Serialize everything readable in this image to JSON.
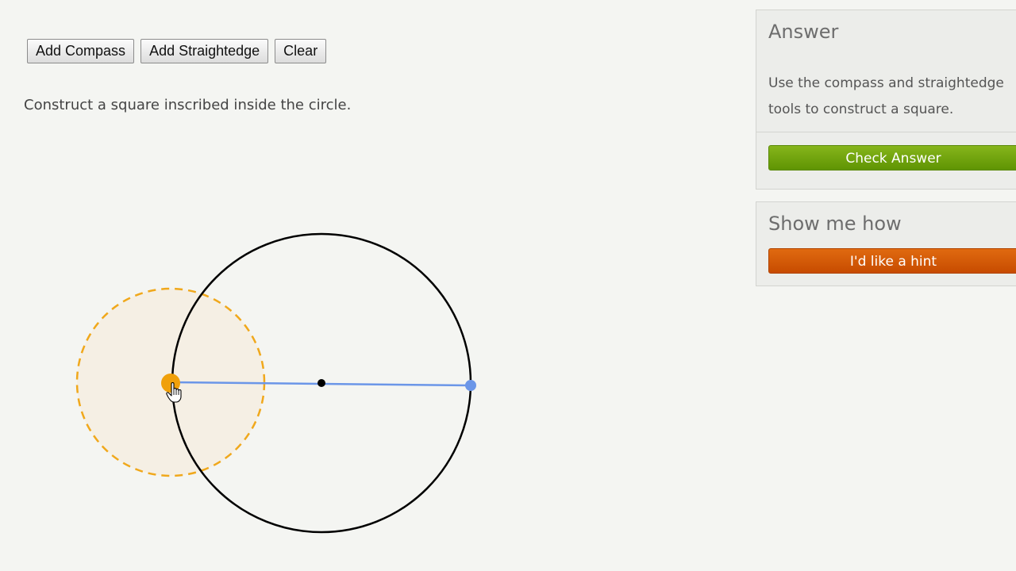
{
  "toolbar": {
    "add_compass_label": "Add Compass",
    "add_straightedge_label": "Add Straightedge",
    "clear_label": "Clear"
  },
  "exercise": {
    "instruction": "Construct a square inscribed inside the circle."
  },
  "answer_panel": {
    "title": "Answer",
    "description": "Use the compass and straightedge tools to construct a square.",
    "check_button_label": "Check Answer",
    "check_button_color": "#6fa40c"
  },
  "hint_panel": {
    "title": "Show me how",
    "hint_button_label": "I'd like a hint",
    "hint_button_color": "#d45a06"
  },
  "colors": {
    "background": "#f4f5f2",
    "compass_stroke": "#f0a81c",
    "compass_fill": "#f5efe4",
    "straightedge": "#6b96e8",
    "circle": "#000000"
  },
  "icons": {
    "cursor": "hand-pointer-icon"
  }
}
